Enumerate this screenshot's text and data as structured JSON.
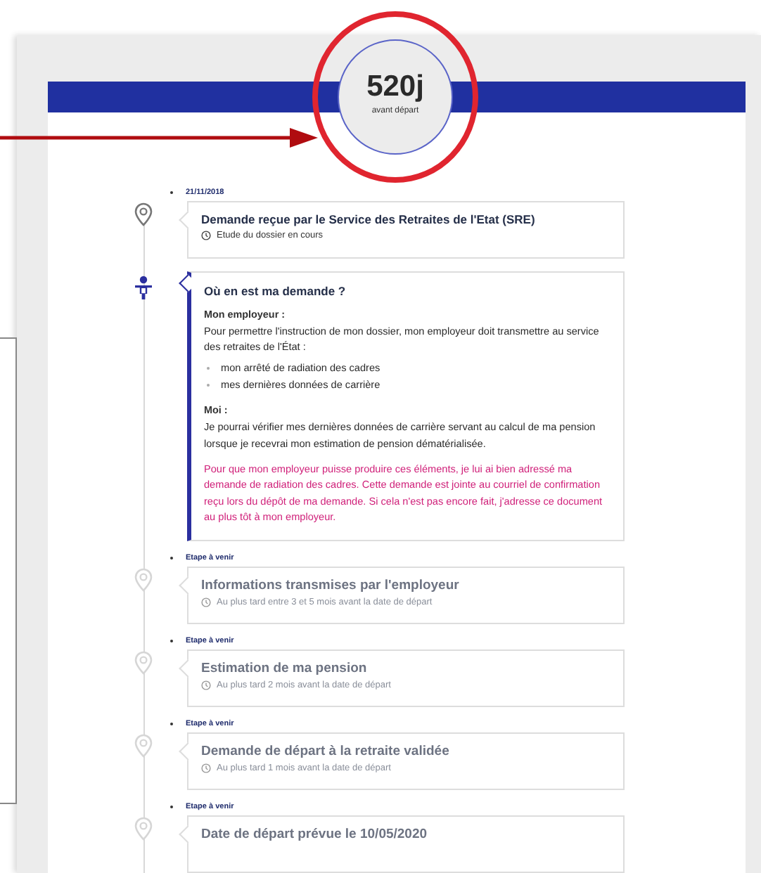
{
  "countdown": {
    "value": "520j",
    "caption": "avant départ"
  },
  "steps": [
    {
      "kind": "done",
      "label": "21/11/2018",
      "title": "Demande reçue par le Service des Retraites de l'Etat (SRE)",
      "note": "Etude du dossier en cours"
    },
    {
      "kind": "current",
      "title": "Où en est ma demande ?",
      "sections": [
        {
          "heading": "Mon employeur :",
          "text": "Pour permettre l'instruction de mon dossier, mon employeur doit transmettre au service des retraites de l'État :",
          "bullets": [
            "mon arrêté de radiation des cadres",
            "mes dernières données de carrière"
          ]
        },
        {
          "heading": "Moi :",
          "text": "Je pourrai vérifier mes dernières données de carrière servant au calcul de ma pension lorsque je recevrai mon estimation de pension dématérialisée."
        }
      ],
      "notice": "Pour que mon employeur puisse produire ces éléments, je lui ai bien adressé ma demande de radiation des cadres. Cette demande est jointe au courriel de confirmation reçu lors du dépôt de ma demande. Si cela n'est pas encore fait, j'adresse ce document au plus tôt à mon employeur."
    },
    {
      "kind": "upcoming",
      "label": "Etape à venir",
      "title": "Informations transmises par l'employeur",
      "note": "Au plus tard entre 3 et 5 mois avant la date de départ"
    },
    {
      "kind": "upcoming",
      "label": "Etape à venir",
      "title": "Estimation de ma pension",
      "note": "Au plus tard 2 mois avant la date de départ"
    },
    {
      "kind": "upcoming",
      "label": "Etape à venir",
      "title": "Demande de départ à la retraite validée",
      "note": "Au plus tard 1 mois avant la date de départ"
    },
    {
      "kind": "upcoming",
      "label": "Etape à venir",
      "title": "Date de départ prévue le 10/05/2020"
    }
  ]
}
